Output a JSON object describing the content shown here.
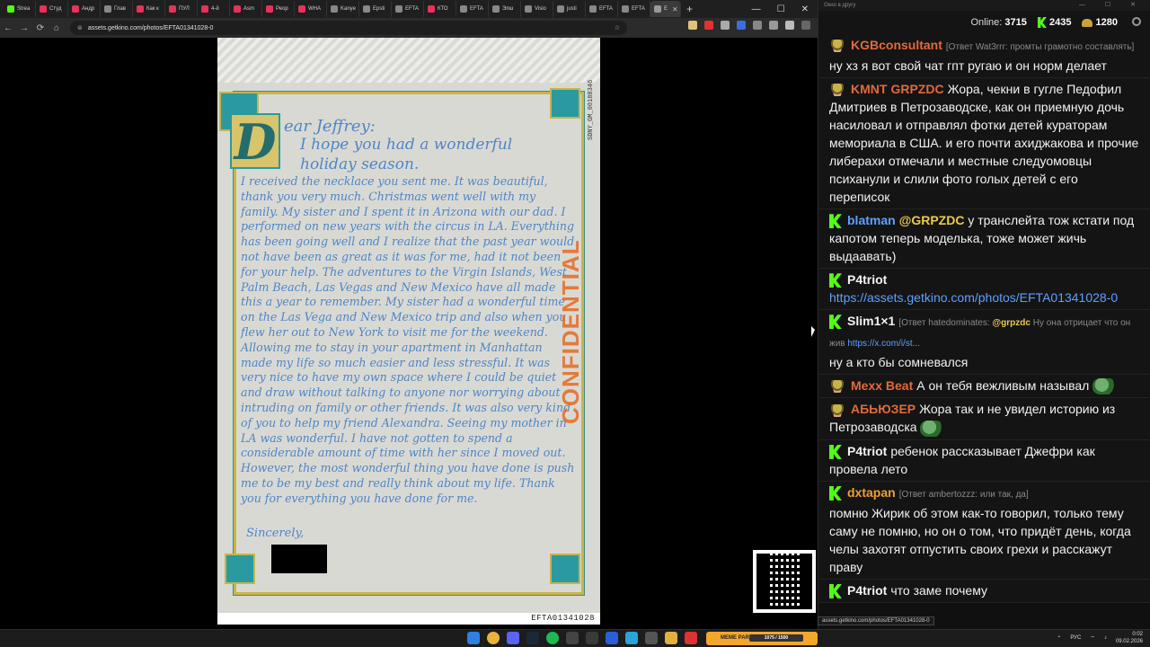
{
  "browser": {
    "tabs": [
      {
        "label": "Strea",
        "color": "#53fc18"
      },
      {
        "label": "Студ",
        "color": "#e8315b"
      },
      {
        "label": "Андр",
        "color": "#e8315b"
      },
      {
        "label": "Глав",
        "color": "#888888"
      },
      {
        "label": "Как к",
        "color": "#e8315b"
      },
      {
        "label": "ПУЛ",
        "color": "#e8315b"
      },
      {
        "label": "4-й",
        "color": "#e8315b"
      },
      {
        "label": "Asm",
        "color": "#e8315b"
      },
      {
        "label": "Реор",
        "color": "#e8315b"
      },
      {
        "label": "WHA",
        "color": "#e8315b"
      },
      {
        "label": "Kanye",
        "color": "#888888"
      },
      {
        "label": "Epsti",
        "color": "#888888"
      },
      {
        "label": "EFTA",
        "color": "#888888"
      },
      {
        "label": "КТО",
        "color": "#e8315b"
      },
      {
        "label": "EFTA",
        "color": "#888888"
      },
      {
        "label": "Эпш",
        "color": "#888888"
      },
      {
        "label": "Visio",
        "color": "#888888"
      },
      {
        "label": "justi",
        "color": "#888888"
      },
      {
        "label": "EFTA",
        "color": "#888888"
      },
      {
        "label": "EFTA",
        "color": "#888888"
      }
    ],
    "active_tab_label": "E",
    "new_tab_symbol": "+",
    "window_controls": {
      "minimize": "—",
      "maximize": "☐",
      "close": "✕"
    },
    "nav": {
      "back": "←",
      "forward": "→",
      "reload": "⟳",
      "home": "⌂"
    },
    "url": "assets.getkino.com/photos/EFTA01341028-0",
    "bookmark_star": "☆"
  },
  "document": {
    "caption": "EFTA01341028",
    "stamp": "SDNY_GM_00188346",
    "watermark": "CONFIDENTIAL",
    "dropcap": "D",
    "greeting": "ear Jeffrey:",
    "intro": "I hope you had a wonderful holiday season.",
    "body": "I received the necklace you sent me. It was beautiful, thank you very much. Christmas went well with my family. My sister and I spent it in Arizona with our dad. I performed on new years with the circus in LA. Everything has been going well and I realize that the past year would not have been as great as it was for me, had it not been for your help. The adventures to the Virgin Islands, West Palm Beach, Las Vegas and New Mexico have all made this a year to remember. My sister had a wonderful time on the Las Vega and New Mexico trip and also when you flew her out to New York to visit me for the weekend. Allowing me to stay in your apartment in Manhattan made my life so much easier and less stressful. It was very nice to have my own space where I could be quiet and draw without talking to anyone nor worrying about intruding on family or other friends. It was also very kind of you to help my friend Alexandra. Seeing my mother in LA was wonderful. I have not gotten to spend a considerable amount of time with her since I moved out. However, the most wonderful thing you have done is push me to be my best and really think about my life. Thank you for everything you have done for me.",
    "signoff": "Sincerely,"
  },
  "chat": {
    "window_title": "Окно в другу",
    "online_label": "Online:",
    "online_count": "3715",
    "kick_count": "2435",
    "coin_count": "1280",
    "messages": [
      {
        "badge": "hat",
        "user": "KGBconsultant",
        "user_color": "#e36a3a",
        "reply": "[Ответ Wat3rrr: промты грамотно составлять]",
        "text": "ну хз я вот свой чат гпт ругаю и он норм делает"
      },
      {
        "badge": "hat",
        "user": "KMNT",
        "user2": "GRPZDC",
        "user_color": "#e36a3a",
        "text": "Жора, чекни в гугле Педофил Дмитриев в Петрозаводске, как он приемную дочь насиловал и отправлял фотки детей кураторам мемориала в США. и его почти ахиджакова и прочие либерахи отмечали и местные следуомовцы психанули и слили фото голых детей с его переписок"
      },
      {
        "badge": "k",
        "user": "blatman",
        "user_color": "#5ea0ff",
        "mention": "@GRPZDC",
        "text": "у транслейта тож кстати под капотом теперь моделька, тоже может жичь выдаавать)"
      },
      {
        "badge": "k",
        "user": "P4triot",
        "user_color": "#f2f2f2",
        "link": "https://assets.getkino.com/photos/EFTA01341028-0"
      },
      {
        "badge": "k",
        "user": "Slim1×1",
        "user_color": "#f2f2f2",
        "reply_prefix": "[Ответ hatedominates:",
        "reply_mention": "@grpzdc",
        "reply_text": "Ну она отрицает что он жив",
        "reply_link": "https://x.com/i/st...",
        "text": "ну а кто бы сомневался"
      },
      {
        "badge": "hat",
        "user": "Mexx Beat",
        "user_color": "#e36a3a",
        "text": "А он тебя вежливым называл",
        "emote": "pepe"
      },
      {
        "badge": "hat",
        "user": "АБЬЮЗЕР",
        "user_color": "#e36a3a",
        "text": "Жора так и не увидел историю из Петрозаводска",
        "emote": "pepe"
      },
      {
        "badge": "k",
        "user": "P4triot",
        "user_color": "#f2f2f2",
        "text": "ребенок рассказывает Джефри как провела лето"
      },
      {
        "badge": "k",
        "user": "dxtapan",
        "user_color": "#f0a030",
        "reply": "[Ответ ambertozzz: или так, да]",
        "text": "помню Жирик об этом как-то говорил, только тему саму не помню, но он о том, что придёт день, когда челы захотят отпустить своих грехи и расскажут праву"
      },
      {
        "badge": "k",
        "user": "P4triot",
        "user_color": "#f2f2f2",
        "text": "что заме почему"
      }
    ],
    "status_url": "assets.getkino.com/photos/EFTA01341028-0"
  },
  "taskbar": {
    "meme_label": "MEME PARTY",
    "meme_progress": "1075 / 1500",
    "lang": "РУС",
    "time": "0:02",
    "date": "09.02.2026"
  }
}
